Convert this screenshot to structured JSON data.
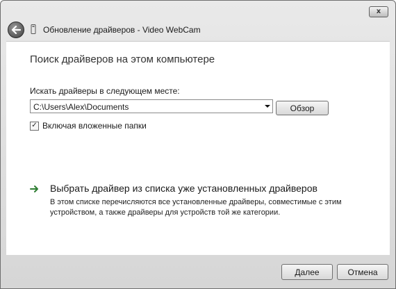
{
  "window": {
    "close_label": "x"
  },
  "nav": {
    "title": "Обновление драйверов - Video WebCam"
  },
  "main": {
    "heading": "Поиск драйверов на этом компьютере",
    "path_label": "Искать драйверы в следующем месте:",
    "path_value": "C:\\Users\\Alex\\Documents",
    "browse_label": "Обзор",
    "subfolders_label": "Включая вложенные папки",
    "subfolders_checked": true,
    "check_mark": "✓",
    "pick_title": "Выбрать драйвер из списка уже установленных драйверов",
    "pick_desc": "В этом списке перечисляются все установленные драйверы, совместимые с этим устройством, а также драйверы для устройств той же категории."
  },
  "footer": {
    "next_label": "Далее",
    "cancel_label": "Отмена"
  },
  "icons": {
    "back": "back-arrow-icon",
    "device": "device-icon",
    "link_arrow": "arrow-right-icon",
    "dropdown": "chevron-down-icon"
  }
}
